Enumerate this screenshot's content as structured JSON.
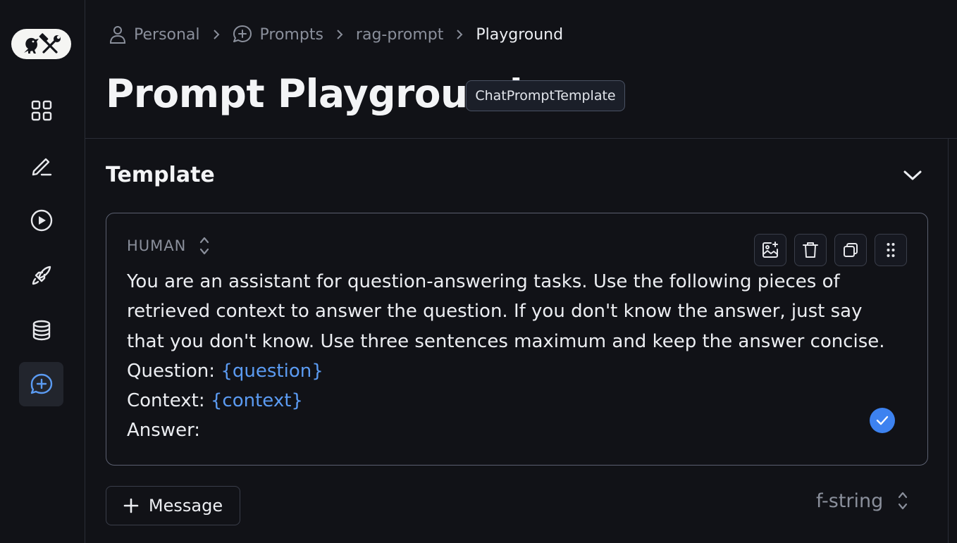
{
  "breadcrumb": {
    "items": [
      {
        "label": "Personal",
        "icon": "user-icon"
      },
      {
        "label": "Prompts",
        "icon": "chat-plus-icon"
      },
      {
        "label": "rag-prompt",
        "icon": ""
      },
      {
        "label": "Playground",
        "icon": ""
      }
    ]
  },
  "header": {
    "title": "Prompt Playground",
    "badge": "ChatPromptTemplate"
  },
  "sidebar": {
    "logo": "parrot-tools-logo",
    "items": [
      {
        "name": "dashboard",
        "icon": "grid-icon",
        "active": false
      },
      {
        "name": "annotate",
        "icon": "pencil-icon",
        "active": false
      },
      {
        "name": "runs",
        "icon": "play-circle-icon",
        "active": false
      },
      {
        "name": "deployments",
        "icon": "rocket-icon",
        "active": false
      },
      {
        "name": "datasets",
        "icon": "database-icon",
        "active": false
      },
      {
        "name": "prompts",
        "icon": "chat-plus-icon",
        "active": true
      }
    ]
  },
  "template": {
    "title": "Template",
    "message": {
      "role": "HUMAN",
      "tools": [
        "add-image-icon",
        "trash-icon",
        "copy-icon",
        "drag-handle-icon"
      ],
      "text_intro": "You are an assistant for question-answering tasks. Use the following pieces of retrieved context to answer the question. If you don't know the answer, just say that you don't know. Use three sentences maximum and keep the answer concise.",
      "question_label": "Question: ",
      "question_var": "{question}",
      "context_label": "Context: ",
      "context_var": "{context}",
      "answer_label": "Answer:"
    },
    "add_message_label": "Message",
    "format": "f-string"
  },
  "colors": {
    "background": "#111217",
    "accent": "#3d82f0",
    "variable": "#5b9bf2"
  }
}
